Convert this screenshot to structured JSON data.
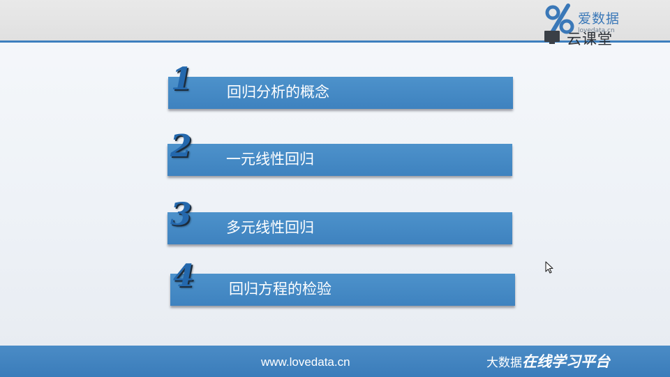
{
  "header": {
    "logo": {
      "brand_top": "爱数据",
      "domain": "lovedata.cn",
      "brand_bottom": "云课堂"
    }
  },
  "agenda": {
    "items": [
      {
        "number": "1",
        "label": "回归分析的概念"
      },
      {
        "number": "2",
        "label": "一元线性回归"
      },
      {
        "number": "3",
        "label": "多元线性回归"
      },
      {
        "number": "4",
        "label": "回归方程的检验"
      }
    ]
  },
  "footer": {
    "url": "www.lovedata.cn",
    "tag_lead": "大数据",
    "tag_emphasis": "在线学习平台"
  },
  "colors": {
    "accent": "#3d7fbe",
    "bar": "#4a8ecb",
    "number": "#2468ad",
    "header_band": "#e4e4e4"
  },
  "icons": [
    "logo-percent-icon",
    "monitor-icon",
    "mouse-pointer-icon"
  ]
}
